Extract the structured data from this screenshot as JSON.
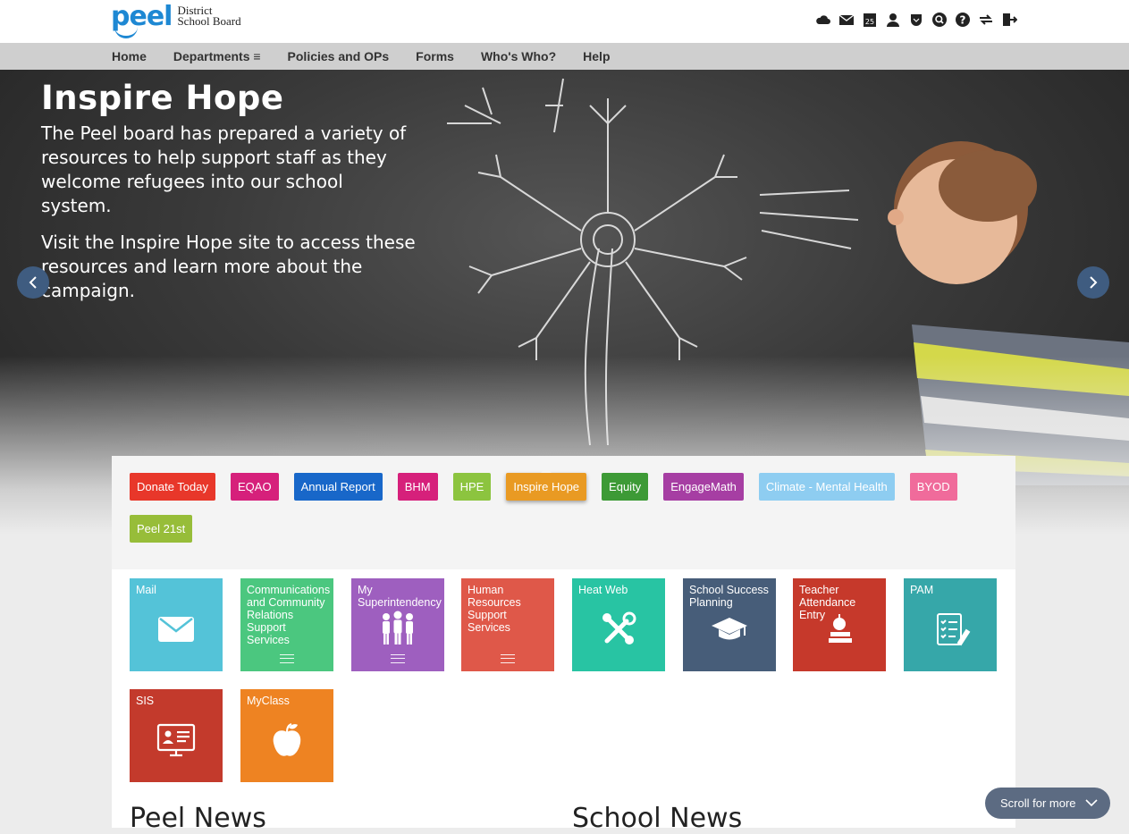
{
  "brand": {
    "word": "peel",
    "line1": "District",
    "line2": "School Board"
  },
  "top_icons": [
    "cloud-icon",
    "mail-icon",
    "calendar-icon",
    "user-icon",
    "shield-icon",
    "search-icon",
    "help-icon",
    "swap-icon",
    "logout-icon"
  ],
  "calendar_day": "25",
  "nav": {
    "items": [
      "Home",
      "Departments ≡",
      "Policies and OPs",
      "Forms",
      "Who's Who?",
      "Help"
    ]
  },
  "hero": {
    "title": "Inspire Hope",
    "paragraph1": "The Peel board has prepared a variety of resources to help support staff as they welcome refugees into our school system.",
    "paragraph2": "Visit the Inspire Hope site to access these resources and learn more about the campaign."
  },
  "tags": [
    {
      "label": "Donate Today",
      "color": "#e8372a"
    },
    {
      "label": "EQAO",
      "color": "#d6207b"
    },
    {
      "label": "Annual Report",
      "color": "#1867c9"
    },
    {
      "label": "BHM",
      "color": "#d6207b"
    },
    {
      "label": "HPE",
      "color": "#8cc43f"
    },
    {
      "label": "Inspire Hope",
      "color": "#e99a23",
      "active": true
    },
    {
      "label": "Equity",
      "color": "#3d9a36"
    },
    {
      "label": "EngageMath",
      "color": "#a63ea3"
    },
    {
      "label": "Climate - Mental Health",
      "color": "#8ecdf1"
    },
    {
      "label": "BYOD",
      "color": "#f06b9b"
    },
    {
      "label": "Peel 21st",
      "color": "#97bd39"
    }
  ],
  "tiles": [
    {
      "label": "Mail",
      "color": "#54c3d8",
      "icon": "envelope-icon",
      "menu": false
    },
    {
      "label": "Communications and Community Relations Support Services",
      "color": "#4bc77f",
      "icon": "none",
      "menu": true
    },
    {
      "label": "My Superintendency",
      "color": "#9e5fbf",
      "icon": "people-icon",
      "menu": true
    },
    {
      "label": "Human Resources Support Services",
      "color": "#df5849",
      "icon": "none",
      "menu": true
    },
    {
      "label": "Heat Web",
      "color": "#28c4a3",
      "icon": "tools-icon",
      "menu": false
    },
    {
      "label": "School Success Planning",
      "color": "#475d79",
      "icon": "graduation-cap-icon",
      "menu": false
    },
    {
      "label": "Teacher Attendance Entry",
      "color": "#c6392b",
      "icon": "apple-books-icon",
      "menu": false
    },
    {
      "label": "PAM",
      "color": "#36a7a9",
      "icon": "checklist-icon",
      "menu": false
    },
    {
      "label": "SIS",
      "color": "#c33a2c",
      "icon": "monitor-icon",
      "menu": false
    },
    {
      "label": "MyClass",
      "color": "#ee8322",
      "icon": "apple-icon",
      "menu": false
    }
  ],
  "news": {
    "left": "Peel News",
    "right": "School News"
  },
  "scroll_more": "Scroll for more"
}
